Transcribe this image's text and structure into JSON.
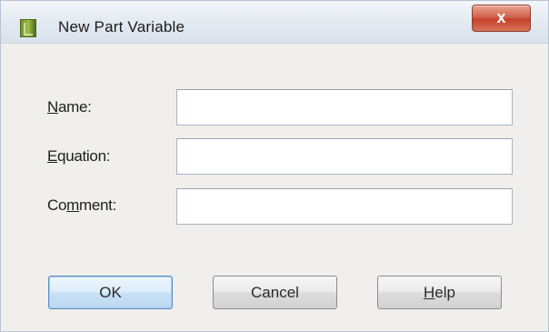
{
  "window": {
    "title": "New Part Variable",
    "close_label": "x",
    "accent": "#c4422b"
  },
  "form": {
    "name": {
      "prefix": "",
      "mnemonic": "N",
      "rest": "ame:",
      "value": ""
    },
    "equation": {
      "prefix": "",
      "mnemonic": "E",
      "rest": "quation:",
      "value": ""
    },
    "comment": {
      "prefix": "Co",
      "mnemonic": "m",
      "rest": "ment:",
      "value": ""
    }
  },
  "buttons": {
    "ok": "OK",
    "cancel": "Cancel",
    "help_mnemonic": "H",
    "help_rest": "elp"
  }
}
